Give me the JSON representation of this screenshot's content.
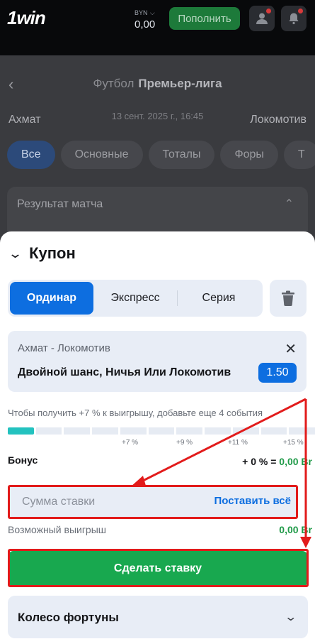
{
  "header": {
    "logo": "1win",
    "currency": "BYN",
    "balance": "0,00",
    "deposit_label": "Пополнить"
  },
  "background": {
    "sport": "Футбол",
    "league": "Премьер-лига",
    "home_team": "Ахмат",
    "away_team": "Локомотив",
    "date": "13 сент. 2025 г., 16:45",
    "chips": [
      "Все",
      "Основные",
      "Тоталы",
      "Форы",
      "Т"
    ],
    "section_title": "Результат матча"
  },
  "coupon": {
    "title": "Купон",
    "tabs": [
      "Ординар",
      "Экспресс",
      "Серия"
    ],
    "active_tab": "Ординар",
    "bet": {
      "match": "Ахмат - Локомотив",
      "outcome": "Двойной шанс, Ничья Или Локомотив",
      "odd": "1.50"
    },
    "bonus_hint": "Чтобы получить +7 % к выигрышу, добавьте еще 4 события",
    "progress": {
      "filled": 1,
      "segments": 11
    },
    "percent_marks": [
      "+7 %",
      "+9 %",
      "+11 %",
      "+15 %"
    ],
    "bonus_label": "Бонус",
    "bonus_value_prefix": "+ 0 % = ",
    "bonus_value_amount": "0,00 Br",
    "stake_placeholder": "Сумма ставки",
    "stake_all_label": "Поставить всё",
    "win_label": "Возможный выигрыш",
    "win_value": "0,00 Br",
    "place_bet_label": "Сделать ставку",
    "wheel_label": "Колесо фортуны"
  },
  "colors": {
    "accent_blue": "#0d6ee0",
    "green_button": "#18a84f",
    "win_green": "#1f9a48",
    "progress_teal": "#23c2bf",
    "annotation_red": "#e21b1b"
  }
}
